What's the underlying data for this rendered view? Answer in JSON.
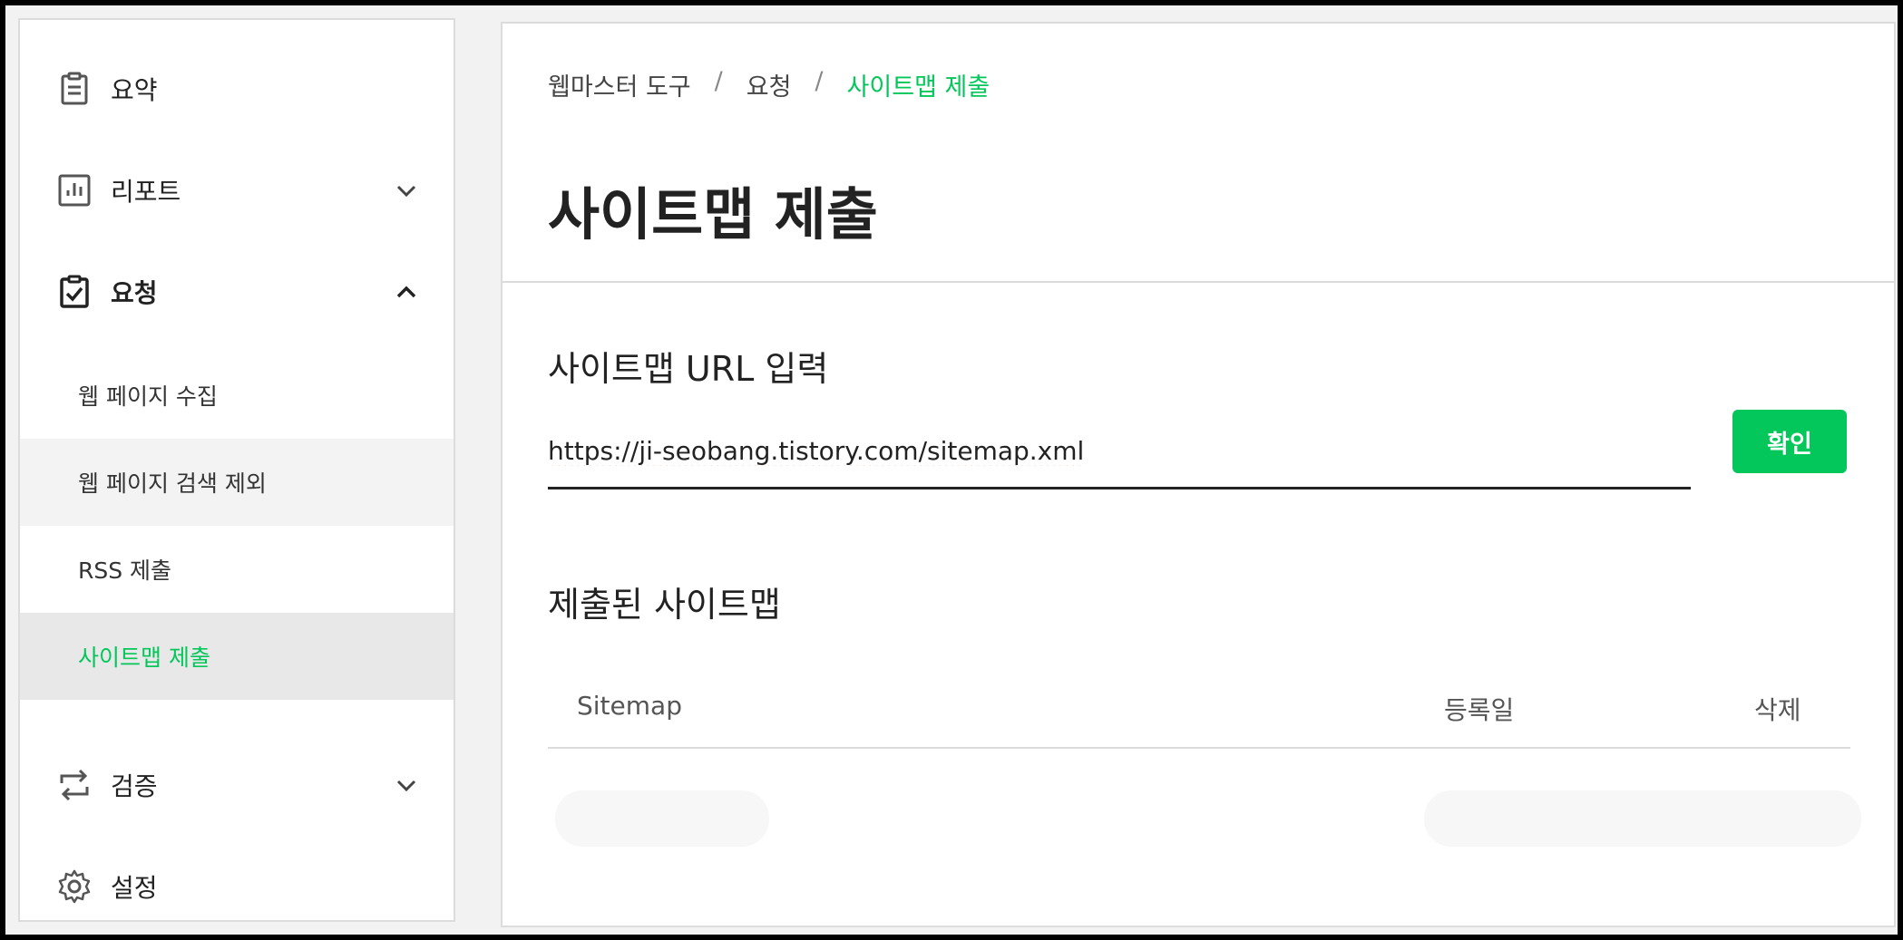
{
  "sidebar": {
    "summary": "요약",
    "report": "리포트",
    "request": "요청",
    "submenu": [
      "웹 페이지 수집",
      "웹 페이지 검색 제외",
      "RSS 제출",
      "사이트맵 제출"
    ],
    "verify": "검증",
    "settings": "설정"
  },
  "breadcrumb": {
    "root": "웹마스터 도구",
    "sep": "/",
    "parent": "요청",
    "current": "사이트맵 제출"
  },
  "page_title": "사이트맵 제출",
  "url_section": {
    "title": "사이트맵 URL 입력",
    "value": "https://ji-seobang.tistory.com/sitemap.xml",
    "button": "확인"
  },
  "submitted_section": {
    "title": "제출된 사이트맵",
    "columns": [
      "Sitemap",
      "등록일",
      "삭제"
    ]
  },
  "colors": {
    "accent": "#03c75a"
  }
}
